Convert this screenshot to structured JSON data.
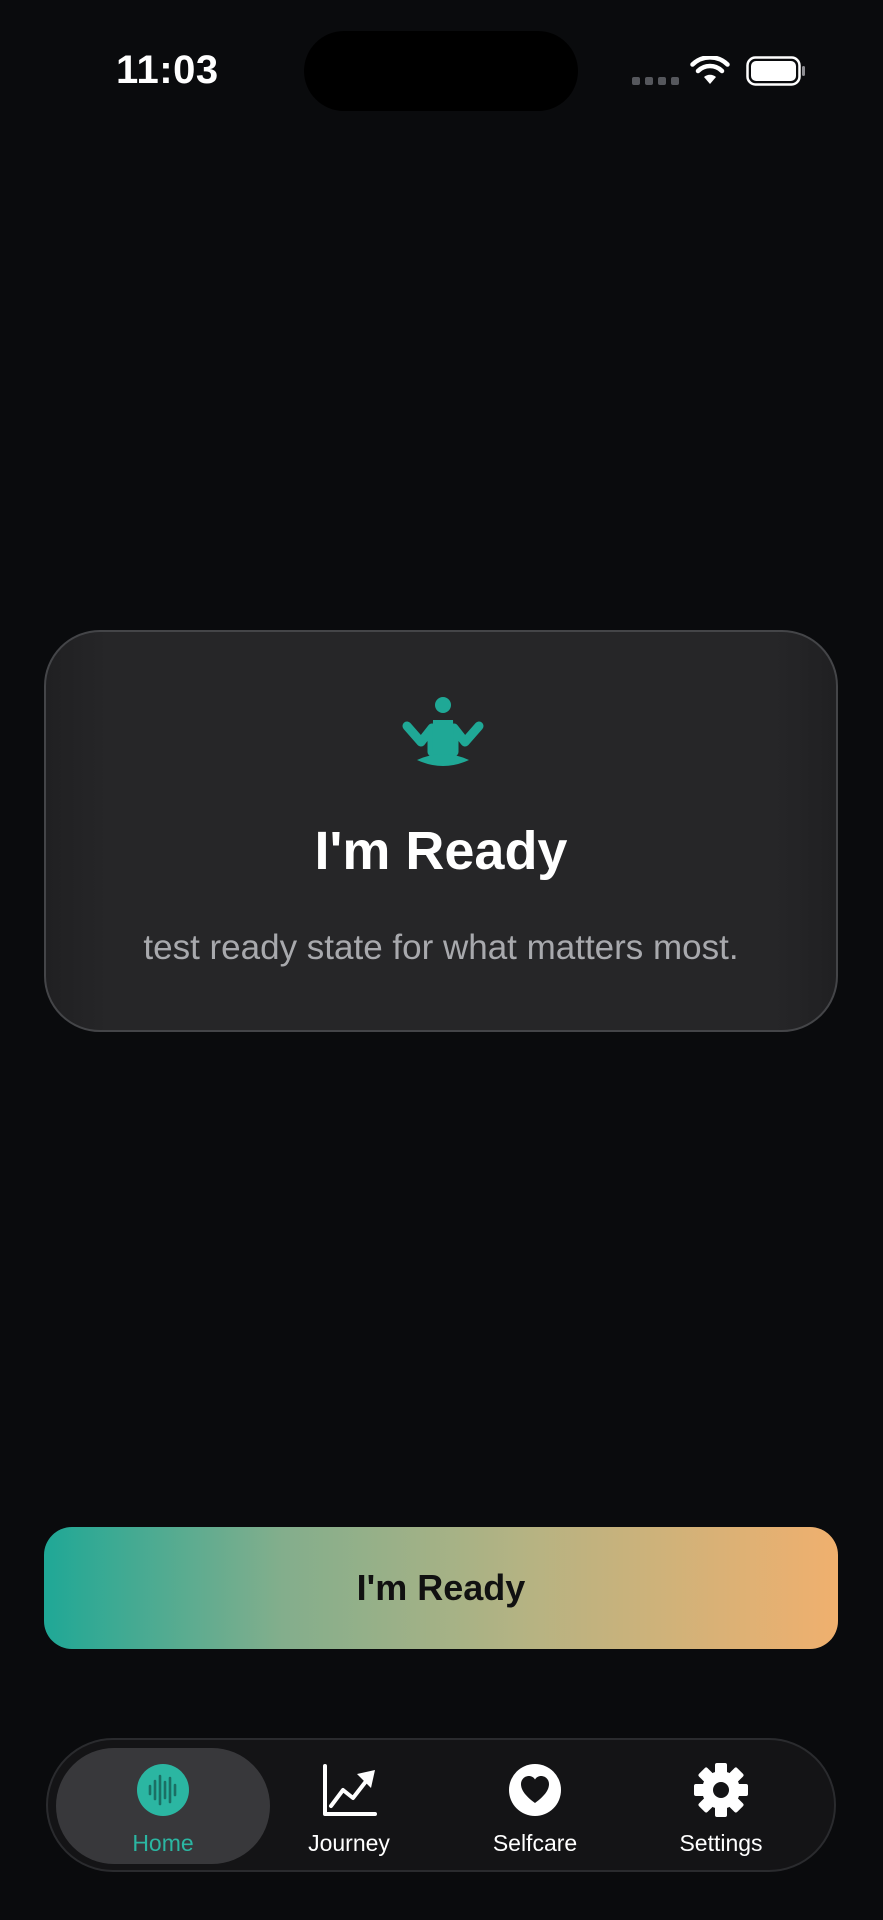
{
  "status_bar": {
    "time": "11:03"
  },
  "card": {
    "icon": "meditation-icon",
    "title": "I'm Ready",
    "subtitle": "test ready state for what matters most."
  },
  "primary_button": {
    "label": "I'm Ready"
  },
  "tab_bar": {
    "tabs": [
      {
        "label": "Home",
        "icon": "waveform-icon",
        "active": true
      },
      {
        "label": "Journey",
        "icon": "chart-up-icon",
        "active": false
      },
      {
        "label": "Selfcare",
        "icon": "heart-icon",
        "active": false
      },
      {
        "label": "Settings",
        "icon": "gear-icon",
        "active": false
      }
    ]
  },
  "colors": {
    "background": "#0a0b0d",
    "accent_teal": "#1fa896",
    "accent_orange": "#f0b06e",
    "card_background": "#262628"
  }
}
